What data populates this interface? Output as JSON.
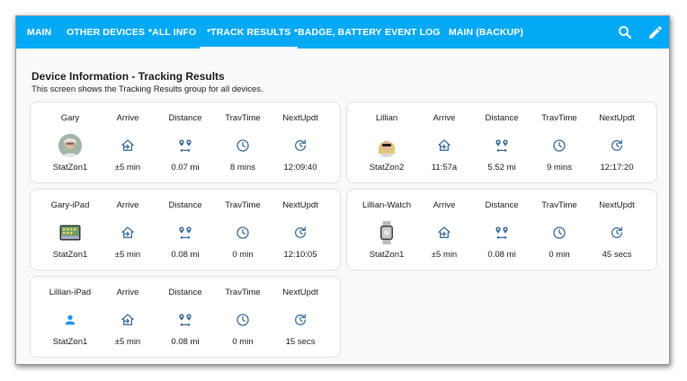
{
  "tabs": [
    {
      "label": "MAIN",
      "active": false
    },
    {
      "label": "OTHER DEVICES",
      "active": false
    },
    {
      "label": "*ALL INFO",
      "active": false
    },
    {
      "label": "*TRACK RESULTS",
      "active": true
    },
    {
      "label": "*BADGE, BATTERY",
      "active": false
    },
    {
      "label": "EVENT LOG",
      "active": false
    },
    {
      "label": "MAIN (BACKUP)",
      "active": false
    }
  ],
  "colors": {
    "header": "#03a9f4",
    "icon": "#44739e",
    "person": "#2196f3"
  },
  "section": {
    "title": "Device Information - Tracking Results",
    "subtitle": "This screen shows the Tracking Results group for all devices."
  },
  "columns": [
    "Arrive",
    "Distance",
    "TravTime",
    "NextUpdt"
  ],
  "devices": [
    {
      "name": "Gary",
      "icon": "gary-photo",
      "zone": "StatZon1",
      "arrive": "±5 min",
      "distance": "0.07 mi",
      "travtime": "8 mins",
      "nextupdt": "12:09:40"
    },
    {
      "name": "Lillian",
      "icon": "lillian-photo",
      "zone": "StatZon2",
      "arrive": "11:57a",
      "distance": "5.52 mi",
      "travtime": "9 mins",
      "nextupdt": "12:17:20"
    },
    {
      "name": "Gary-iPad",
      "icon": "ipad-icon",
      "zone": "StatZon1",
      "arrive": "±5 min",
      "distance": "0.08 mi",
      "travtime": "0 min",
      "nextupdt": "12:10:05"
    },
    {
      "name": "Lillian-Watch",
      "icon": "watch-icon",
      "zone": "StatZon1",
      "arrive": "±5 min",
      "distance": "0.08 mi",
      "travtime": "0 min",
      "nextupdt": "45 secs"
    },
    {
      "name": "Lillian-iPad",
      "icon": "person-icon",
      "zone": "StatZon1",
      "arrive": "±5 min",
      "distance": "0.08 mi",
      "travtime": "0 min",
      "nextupdt": "15 secs"
    }
  ]
}
